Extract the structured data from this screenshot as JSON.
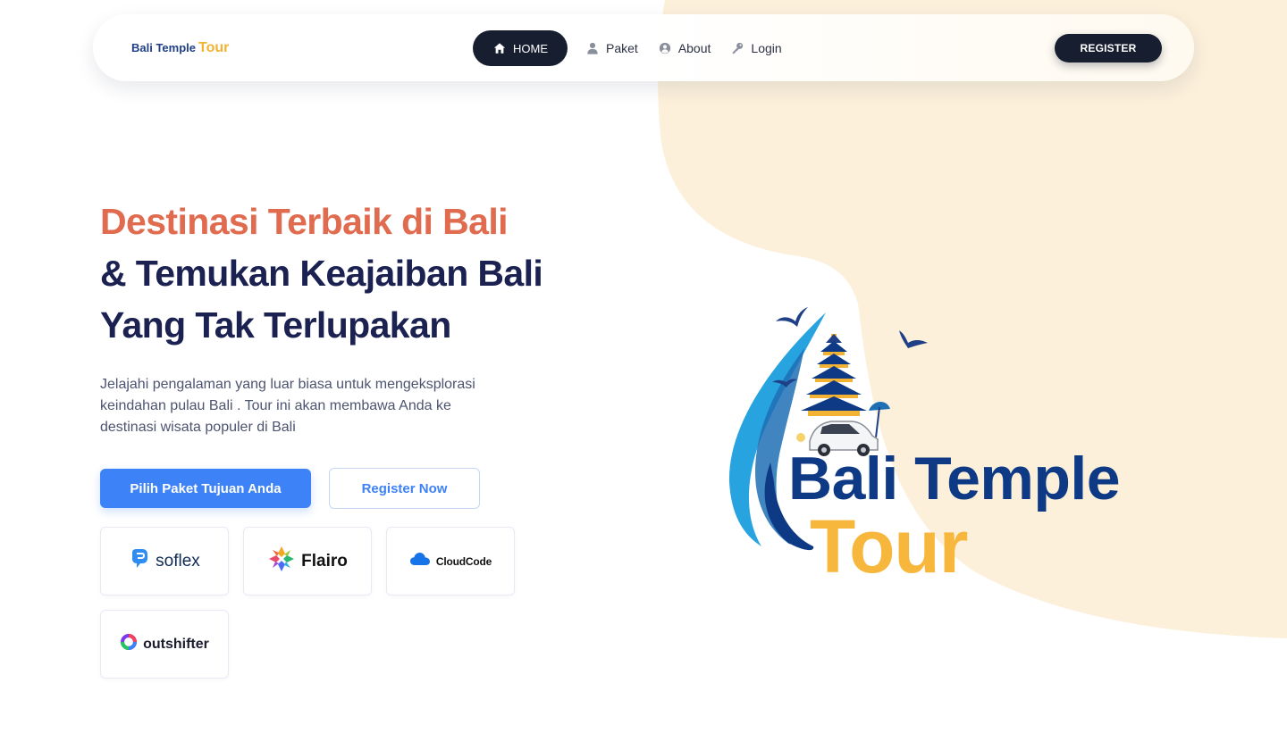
{
  "brand": {
    "part1": "Bali Temple",
    "part2": "Tour"
  },
  "nav": {
    "items": [
      {
        "label": "HOME",
        "icon": "home-icon",
        "active": true
      },
      {
        "label": "Paket",
        "icon": "user-icon",
        "active": false
      },
      {
        "label": "About",
        "icon": "user-circle-icon",
        "active": false
      },
      {
        "label": "Login",
        "icon": "key-icon",
        "active": false
      }
    ],
    "register_label": "REGISTER"
  },
  "hero": {
    "headline_1": "Destinasi Terbaik di Bali",
    "headline_2": "& Temukan Keajaiban Bali",
    "headline_3": "Yang Tak Terlupakan",
    "description": "Jelajahi pengalaman yang luar biasa untuk mengeksplorasi keindahan pulau Bali . Tour ini akan membawa Anda ke destinasi wisata populer di Bali",
    "primary_cta": "Pilih Paket Tujuan Anda",
    "secondary_cta": "Register Now"
  },
  "partners": [
    {
      "name": "soflex",
      "icon": "soflex-logo-icon"
    },
    {
      "name": "Flairo",
      "icon": "flairo-logo-icon"
    },
    {
      "name": "CloudCode",
      "icon": "cloud-icon"
    },
    {
      "name": "outshifter",
      "icon": "outshifter-logo-icon"
    }
  ],
  "hero_logo": {
    "line1": "Bali Temple",
    "line2": "Tour"
  },
  "colors": {
    "accent": "#e06b4f",
    "heading": "#1b2150",
    "primary": "#3e82f7",
    "nav_dark": "#161e30",
    "blob": "#fcf0db",
    "logo_blue": "#0e3a85",
    "logo_gold": "#f6b73c"
  }
}
